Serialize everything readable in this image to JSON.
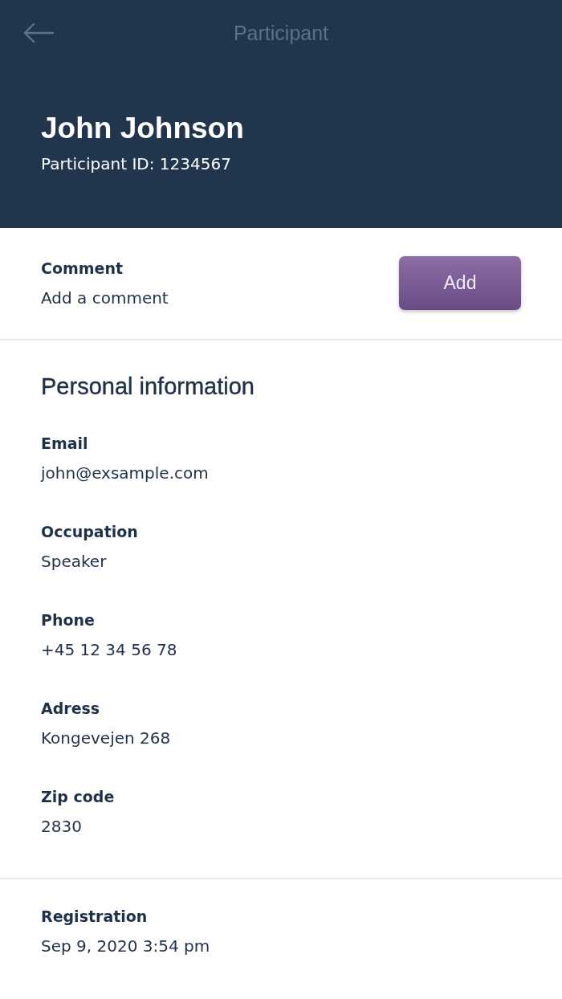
{
  "header": {
    "title": "Participant",
    "name": "John Johnson",
    "participant_id": "Participant ID: 1234567"
  },
  "comment": {
    "label": "Comment",
    "value": "Add a comment",
    "button": "Add"
  },
  "personal_information": {
    "heading": "Personal information",
    "fields": [
      {
        "label": "Email",
        "value": "john@exsample.com"
      },
      {
        "label": "Occupation",
        "value": "Speaker"
      },
      {
        "label": "Phone",
        "value": "+45 12 34 56 78"
      },
      {
        "label": "Adress",
        "value": "Kongevejen 268"
      },
      {
        "label": "Zip code",
        "value": "2830"
      }
    ]
  },
  "registration": {
    "label": "Registration",
    "value": "Sep 9, 2020 3:54 pm"
  }
}
